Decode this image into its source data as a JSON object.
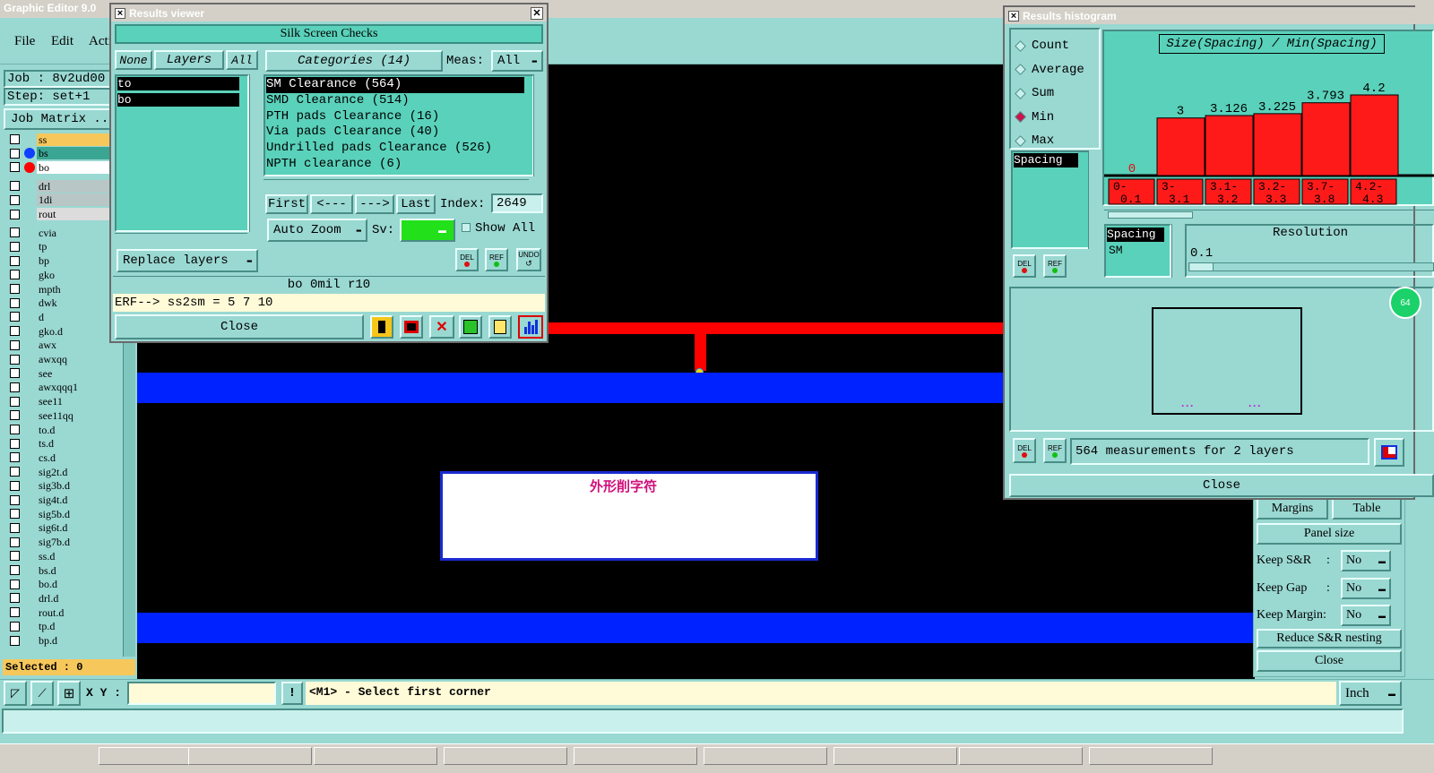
{
  "app": {
    "title": "Graphic Editor 9.0",
    "menu": [
      "File",
      "Edit",
      "Acti"
    ]
  },
  "job": {
    "label": "Job : 8v2ud00",
    "step": "Step: set+1",
    "matrix_button": "Job Matrix ..."
  },
  "layers": [
    {
      "name": "ss",
      "color": "#f6c75a",
      "swatch": ""
    },
    {
      "name": "bs",
      "color": "#3aa593",
      "swatch": "#1040ff"
    },
    {
      "name": "bo",
      "color": "#ffffff",
      "swatch": "#ff0000"
    },
    {
      "name": "drl",
      "color": "#b8c6c6"
    },
    {
      "name": "1di",
      "color": "#b8c6c6"
    },
    {
      "name": "rout",
      "color": "#dcdcdc"
    },
    {
      "name": "cvia",
      "color": "#9ad8d2"
    },
    {
      "name": "tp",
      "color": "#9ad8d2"
    },
    {
      "name": "bp",
      "color": "#9ad8d2"
    },
    {
      "name": "gko",
      "color": "#9ad8d2"
    },
    {
      "name": "mpth",
      "color": "#9ad8d2"
    },
    {
      "name": "dwk",
      "color": "#9ad8d2"
    },
    {
      "name": "d",
      "color": "#9ad8d2"
    },
    {
      "name": "gko.d",
      "color": "#9ad8d2"
    },
    {
      "name": "awx",
      "color": "#9ad8d2"
    },
    {
      "name": "awxqq",
      "color": "#9ad8d2"
    },
    {
      "name": "see",
      "color": "#9ad8d2"
    },
    {
      "name": "awxqqq1",
      "color": "#9ad8d2"
    },
    {
      "name": "see11",
      "color": "#9ad8d2"
    },
    {
      "name": "see11qq",
      "color": "#9ad8d2"
    },
    {
      "name": "to.d",
      "color": "#9ad8d2"
    },
    {
      "name": "ts.d",
      "color": "#9ad8d2"
    },
    {
      "name": "cs.d",
      "color": "#9ad8d2"
    },
    {
      "name": "sig2t.d",
      "color": "#9ad8d2"
    },
    {
      "name": "sig3b.d",
      "color": "#9ad8d2"
    },
    {
      "name": "sig4t.d",
      "color": "#9ad8d2"
    },
    {
      "name": "sig5b.d",
      "color": "#9ad8d2"
    },
    {
      "name": "sig6t.d",
      "color": "#9ad8d2"
    },
    {
      "name": "sig7b.d",
      "color": "#9ad8d2"
    },
    {
      "name": "ss.d",
      "color": "#9ad8d2"
    },
    {
      "name": "bs.d",
      "color": "#9ad8d2"
    },
    {
      "name": "bo.d",
      "color": "#9ad8d2"
    },
    {
      "name": "drl.d",
      "color": "#9ad8d2"
    },
    {
      "name": "rout.d",
      "color": "#9ad8d2"
    },
    {
      "name": "tp.d",
      "color": "#9ad8d2"
    },
    {
      "name": "bp.d",
      "color": "#9ad8d2"
    }
  ],
  "selected": "Selected : 0",
  "canvas": {
    "text_label": "外形削字符"
  },
  "results_viewer": {
    "title": "Results viewer",
    "header": "Silk Screen Checks",
    "none": "None",
    "layers_btn": "Layers",
    "all": "All",
    "categories_btn": "Categories (14)",
    "meas_label": "Meas:",
    "meas_value": "All",
    "layer_list": [
      "to",
      "bo"
    ],
    "categories": [
      "SM Clearance (564)",
      "SMD Clearance (514)",
      "PTH pads Clearance (16)",
      "Via pads Clearance (40)",
      "Undrilled pads Clearance (526)",
      "NPTH clearance (6)"
    ],
    "first": "First",
    "prev": "<---",
    "next": "--->",
    "last": "Last",
    "index_label": "Index:",
    "index_value": "2649",
    "auto_zoom": "Auto Zoom",
    "sv_label": "Sv:",
    "show_all": "Show All",
    "replace_layers": "Replace layers",
    "del": "DEL",
    "ref": "REF",
    "undo": "UNDO",
    "status": "bo  0mil  r10",
    "erf": "ERF--> ss2sm = 5 7 10",
    "close": "Close"
  },
  "histogram": {
    "title": "Results histogram",
    "modes": [
      "Count",
      "Average",
      "Sum",
      "Min",
      "Max"
    ],
    "selected_mode": "Min",
    "formula": "Size(Spacing) / Min(Spacing)",
    "list_top": "Spacing",
    "list2": [
      "Spacing",
      "SM"
    ],
    "resolution_label": "Resolution",
    "resolution_value": "0.1",
    "summary": "564 measurements for 2 layers",
    "close": "Close",
    "del": "DEL",
    "ref": "REF",
    "badge": "64"
  },
  "chart_data": {
    "type": "bar",
    "title": "Size(Spacing) / Min(Spacing)",
    "categories": [
      "0-0.1",
      "3-3.1",
      "3.1-3.2",
      "3.2-3.3",
      "3.7-3.8",
      "4.2-4.3"
    ],
    "values": [
      0,
      3,
      3.126,
      3.225,
      3.793,
      4.2
    ],
    "value_labels": [
      "0",
      "3",
      "3.126",
      "3.225",
      "3.793",
      "4.2"
    ],
    "bar_color": "#ff1a1a"
  },
  "panel_right": {
    "margins": "Margins",
    "table": "Table",
    "panel_size": "Panel size",
    "keep_sr": "Keep S&R",
    "keep_gap": "Keep Gap",
    "keep_margin": "Keep Margin:",
    "no": "No",
    "reduce": "Reduce S&R nesting",
    "close": "Close"
  },
  "bottom": {
    "xy_label": "X Y :",
    "xy_value": "",
    "excl": "!",
    "prompt": "<M1> - Select first corner",
    "units": "Inch"
  }
}
